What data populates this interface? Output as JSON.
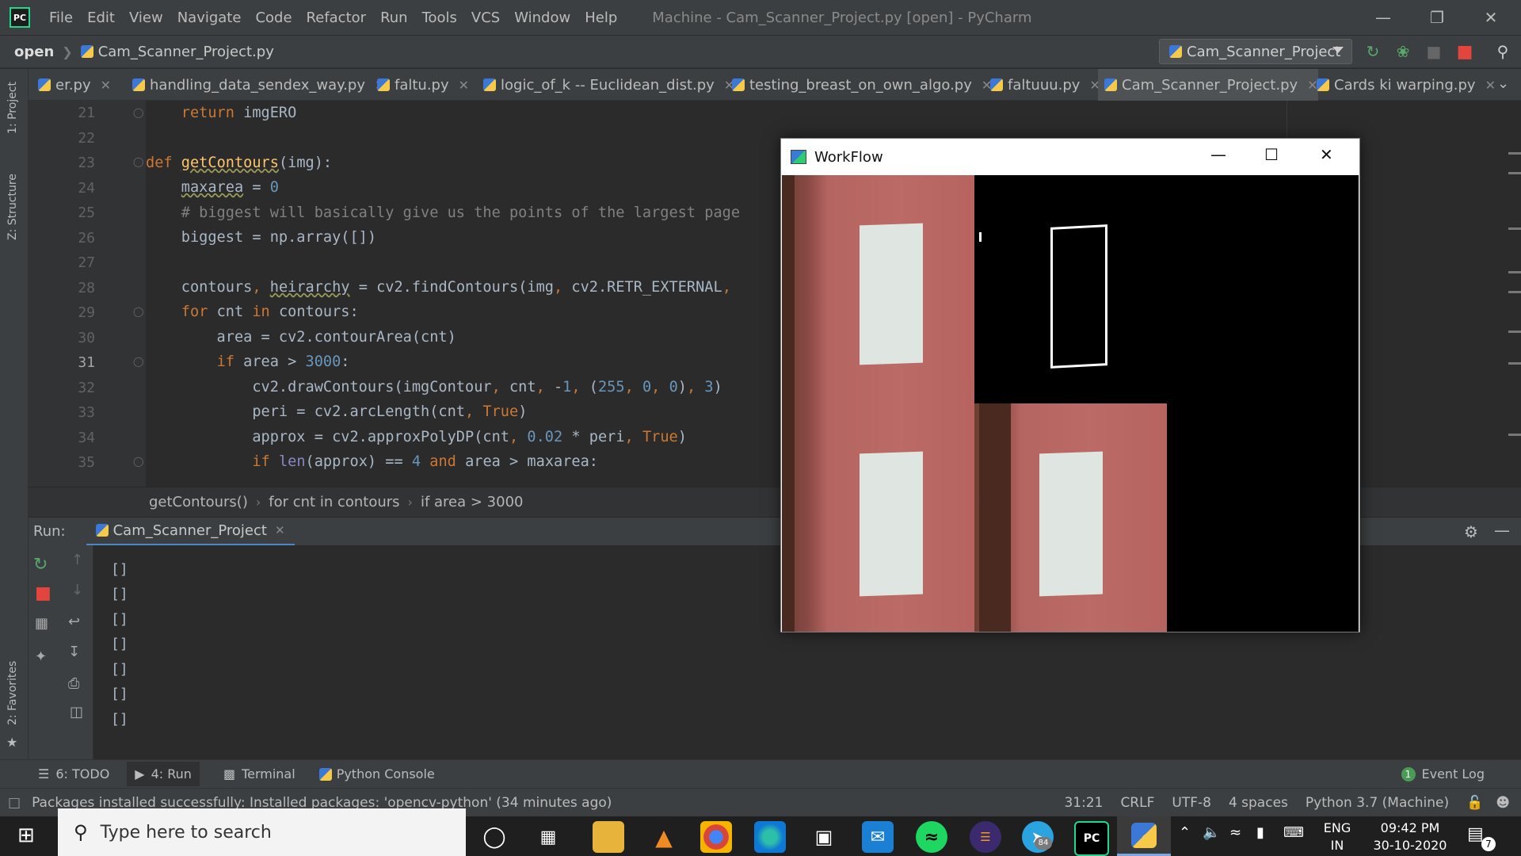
{
  "menubar": {
    "app_logo": "PC",
    "items": [
      "File",
      "Edit",
      "View",
      "Navigate",
      "Code",
      "Refactor",
      "Run",
      "Tools",
      "VCS",
      "Window",
      "Help"
    ],
    "window_title": "Machine - Cam_Scanner_Project.py [open] - PyCharm"
  },
  "navbar": {
    "root": "open",
    "file": "Cam_Scanner_Project.py",
    "run_config": "Cam_Scanner_Project"
  },
  "tabs": [
    {
      "label": "er.py"
    },
    {
      "label": "handling_data_sendex_way.py"
    },
    {
      "label": "faltu.py"
    },
    {
      "label": "logic_of_k -- Euclidean_dist.py"
    },
    {
      "label": "testing_breast_on_own_algo.py"
    },
    {
      "label": "faltuuu.py"
    },
    {
      "label": "Cam_Scanner_Project.py",
      "active": true
    },
    {
      "label": "Cards ki warping.py"
    }
  ],
  "side_tools": {
    "project": "1: Project",
    "structure": "Z: Structure",
    "favorites": "2: Favorites"
  },
  "editor": {
    "line_numbers": [
      "21",
      "22",
      "23",
      "24",
      "25",
      "26",
      "27",
      "28",
      "29",
      "30",
      "31",
      "32",
      "33",
      "34",
      "35"
    ],
    "current_line": "31"
  },
  "breadcrumb": [
    "getContours()",
    "for cnt in contours",
    "if area > 3000"
  ],
  "run_panel": {
    "label": "Run:",
    "tab": "Cam_Scanner_Project",
    "output": [
      "[]",
      "[]",
      "[]",
      "[]",
      "[]",
      "[]",
      "[]"
    ]
  },
  "bottom_tools": {
    "todo": "6: TODO",
    "run": "4: Run",
    "terminal": "Terminal",
    "python_console": "Python Console",
    "event_log": "Event Log",
    "event_count": "1"
  },
  "statusbar": {
    "message": "Packages installed successfully: Installed packages: 'opencv-python' (34 minutes ago)",
    "position": "31:21",
    "line_sep": "CRLF",
    "encoding": "UTF-8",
    "indent": "4 spaces",
    "interpreter": "Python 3.7 (Machine)"
  },
  "cv_window": {
    "title": "WorkFlow"
  },
  "taskbar": {
    "search_placeholder": "Type here to search",
    "lang": "ENG",
    "region": "IN",
    "time": "09:42 PM",
    "date": "30-10-2020",
    "notifications": "7",
    "telegram_badge": "84"
  },
  "colors": {
    "keyword": "#cc7832",
    "function": "#ffc66d",
    "number": "#6897bb",
    "comment": "#808080",
    "accent": "#4a88c7"
  }
}
